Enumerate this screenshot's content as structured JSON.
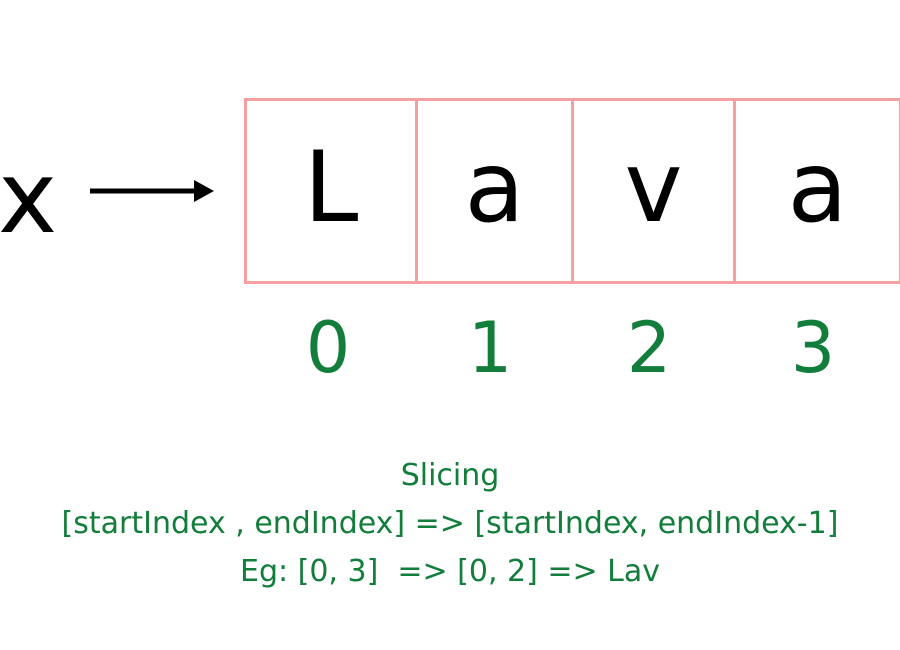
{
  "variable": {
    "name": "x"
  },
  "string_cells": [
    {
      "char": "L"
    },
    {
      "char": "a"
    },
    {
      "char": "v"
    },
    {
      "char": "a"
    }
  ],
  "indices": [
    "0",
    "1",
    "2",
    "3"
  ],
  "caption": {
    "title": "Slicing",
    "rule": "[startIndex , endIndex] => [startIndex, endIndex-1]",
    "example": "Eg: [0, 3]  => [0, 2] => Lav"
  },
  "colors": {
    "cell_border": "#f4a0a0",
    "index_and_caption": "#137d3b",
    "text": "#000000"
  }
}
